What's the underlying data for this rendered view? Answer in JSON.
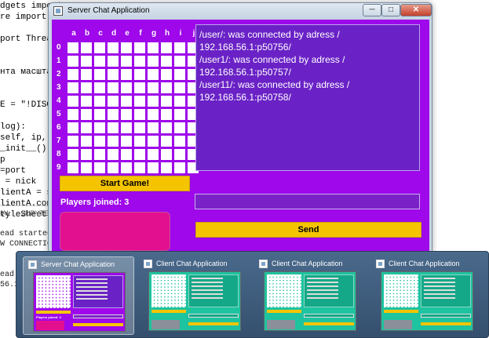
{
  "ide": {
    "code_lines": [
      "dgets import",
      "re import Qt",
      "",
      "port Thread",
      "",
      "",
      "нта масштабл",
      "",
      "",
      "E = \"!DISCONN",
      "",
      "log):",
      "self, ip, por",
      "_init__()",
      "p",
      "=port",
      " = nick",
      "lientA = sock",
      "lientA.connec",
      "tyleSheet(\"b"
    ],
    "tabs": [
      "IAL",
      "JUPYTER"
    ],
    "output_lines": [
      "ead started fo",
      "W CONNECTION]",
      "",
      "",
      "ead st",
      "56.1:5"
    ]
  },
  "server_window": {
    "title": "Server Chat Application",
    "min_glyph": "─",
    "max_glyph": "□",
    "close_glyph": "✕",
    "grid": {
      "columns": [
        "a",
        "b",
        "c",
        "d",
        "e",
        "f",
        "g",
        "h",
        "i",
        "j"
      ],
      "rows": [
        "0",
        "1",
        "2",
        "3",
        "4",
        "5",
        "6",
        "7",
        "8",
        "9"
      ]
    },
    "chat_lines": [
      "/user/: was connected by adress /",
      "192.168.56.1:p50756/",
      "/user1/: was connected by adress /",
      "192.168.56.1:p50757/",
      "/user11/: was connected by adress /",
      "192.168.56.1:p50758/"
    ],
    "start_button": "Start Game!",
    "players_joined": "Players joined: 3",
    "message_input_value": "",
    "send_button": "Send"
  },
  "taskbar_previews": [
    {
      "title": "Server Chat Application",
      "kind": "server",
      "active": true
    },
    {
      "title": "Client Chat Application",
      "kind": "client",
      "active": false
    },
    {
      "title": "Client Chat Application",
      "kind": "client",
      "active": false
    },
    {
      "title": "Client Chat Application",
      "kind": "client",
      "active": false
    }
  ],
  "colors": {
    "server_bg": "#9e08ea",
    "client_bg": "#1ec3a0",
    "button_yellow": "#f5c400",
    "magenta": "#e2108f"
  }
}
